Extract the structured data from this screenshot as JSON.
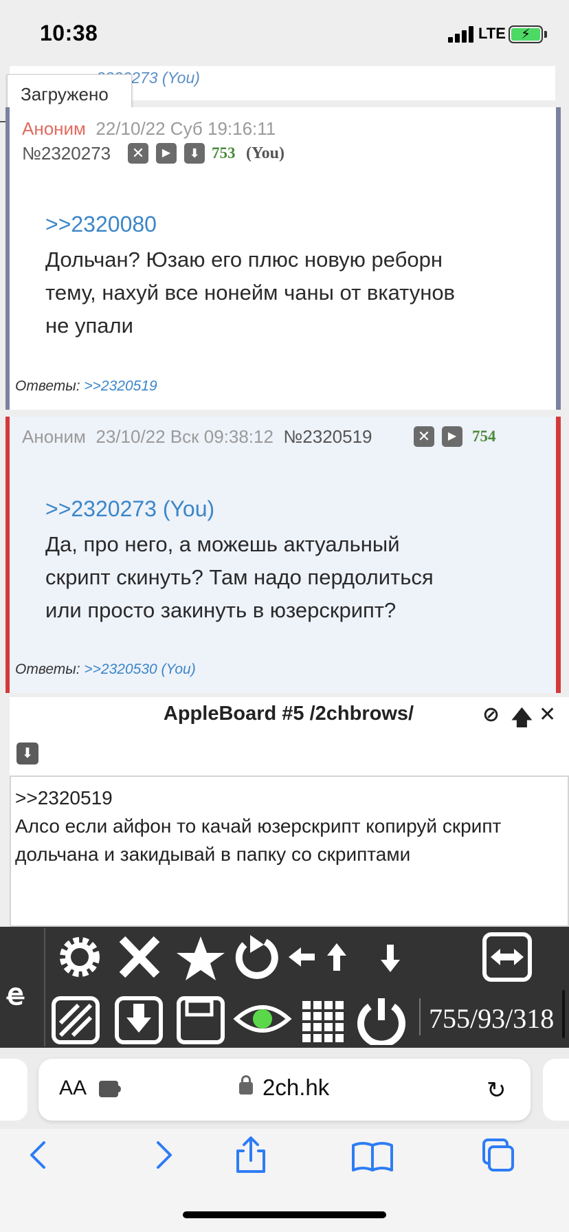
{
  "status_bar": {
    "time": "10:38",
    "network": "LTE"
  },
  "tooltip": {
    "text": "Загружено"
  },
  "prev_post": {
    "link": "2320273 (You)"
  },
  "posts": [
    {
      "author": "Аноним",
      "date": "22/10/22 Суб 19:16:11",
      "number": "№2320273",
      "count": "753",
      "you_label": "(You)",
      "reflink": ">>2320080",
      "lines": [
        "Дольчан? Юзаю его плюс новую реборн",
        "тему, нахуй все нонейм чаны от вкатунов",
        "не упали"
      ],
      "replies_label": "Ответы:",
      "replies_link": ">>2320519"
    },
    {
      "author": "Аноним",
      "date": "23/10/22 Вск 09:38:12",
      "number": "№2320519",
      "count": "754",
      "reflink": ">>2320273 (You)",
      "lines": [
        "Да, про него, а можешь актуальный",
        "скрипт скинуть? Там надо пердолиться",
        "или просто закинуть в юзерскрипт?"
      ],
      "replies_label": "Ответы:",
      "replies_link": ">>2320530 (You)"
    }
  ],
  "reply_form": {
    "title": "AppleBoard #5 /2chbrows/",
    "lines": [
      ">>2320519",
      "Алсо если айфон то качай юзерскрипт копируй скрипт",
      "дольчана и закидывай в папку со скриптами"
    ]
  },
  "toolbar": {
    "counter": "755/93/318",
    "logo": "ꬳ"
  },
  "browser": {
    "aa_label": "AA",
    "url": "2ch.hk"
  },
  "colors": {
    "accent_link": "#3b86c8",
    "author_red": "#e06b5f",
    "op_border": "#7a829e",
    "reply_border": "#d23a3a",
    "ios_blue": "#2d7cf6"
  }
}
